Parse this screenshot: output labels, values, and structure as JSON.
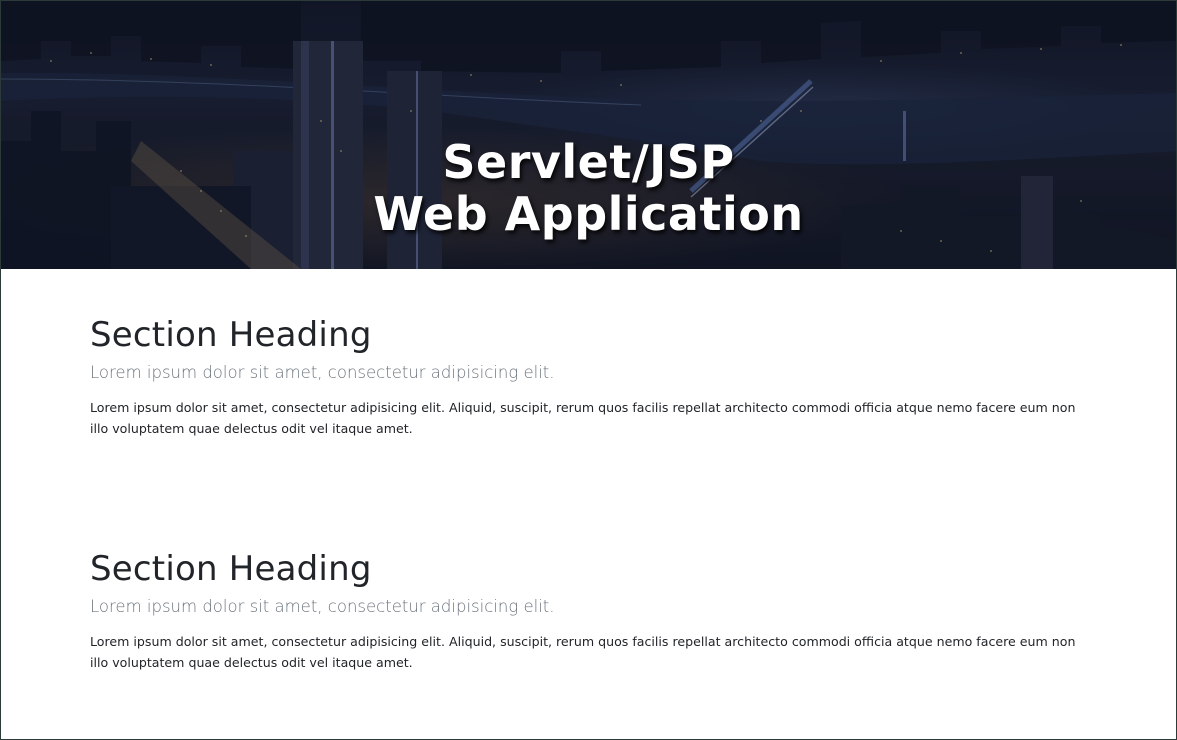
{
  "hero": {
    "title_line1": "Servlet/JSP",
    "title_line2": "Web Application"
  },
  "sections": [
    {
      "heading": "Section Heading",
      "lead": "Lorem ipsum dolor sit amet, consectetur adipisicing elit.",
      "body": "Lorem ipsum dolor sit amet, consectetur adipisicing elit. Aliquid, suscipit, rerum quos facilis repellat architecto commodi officia atque nemo facere eum non illo voluptatem quae delectus odit vel itaque amet."
    },
    {
      "heading": "Section Heading",
      "lead": "Lorem ipsum dolor sit amet, consectetur adipisicing elit.",
      "body": "Lorem ipsum dolor sit amet, consectetur adipisicing elit. Aliquid, suscipit, rerum quos facilis repellat architecto commodi officia atque nemo facere eum non illo voluptatem quae delectus odit vel itaque amet."
    }
  ]
}
